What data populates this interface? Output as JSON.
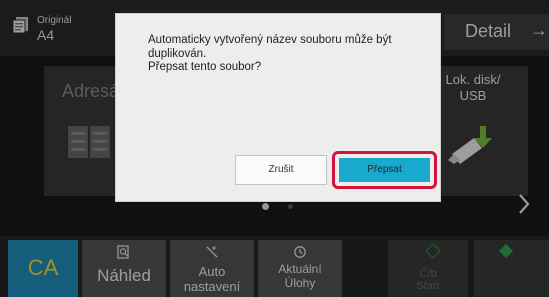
{
  "header": {
    "original_label": "Originál",
    "original_value": "A4",
    "detail_label": "Detail"
  },
  "main": {
    "address_tile_label": "Adresá",
    "local_disk_label": "Lok. disk/\nUSB"
  },
  "footer": {
    "ca_label": "CA",
    "preview_label": "Náhled",
    "auto_label": "Auto\nnastavení",
    "tasks_label": "Aktuální\nÚlohy",
    "cb_label": "Č/b\nStart"
  },
  "dialog": {
    "message_lines": [
      "Automaticky vytvořený název souboru může být",
      "duplikován.",
      "Přepsat tento soubor?"
    ],
    "cancel_label": "Zrušit",
    "confirm_label": "Přepsat"
  },
  "colors": {
    "ca_background": "#1f8fbd",
    "ca_text": "#ffdb33",
    "confirm_button": "#19a9cc",
    "highlight_outline": "#d4143e",
    "start_icon": "#2fa84f"
  },
  "icons": {
    "original": "document-stack-icon",
    "detail": "arrow-right-icon",
    "address_book": "address-book-icon",
    "local_disk": "usb-download-icon",
    "next_page": "chevron-right-icon",
    "preview": "magnifier-document-icon",
    "auto": "sparkle-icon",
    "tasks": "clock-history-icon",
    "bw_start": "diamond-start-icon",
    "color_start": "diamond-start-icon"
  }
}
